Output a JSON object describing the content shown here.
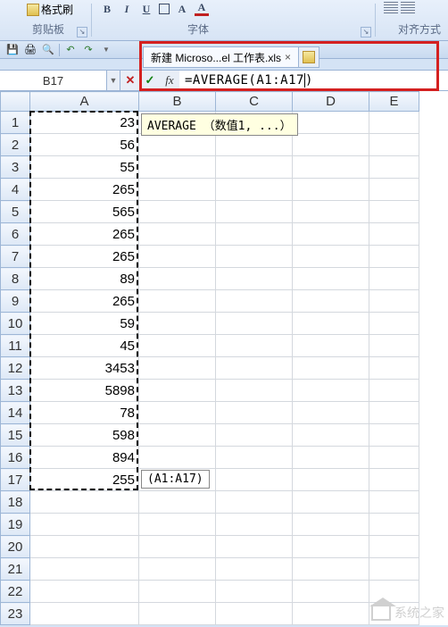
{
  "ribbon": {
    "format_painter": "格式刷",
    "group_clipboard": "剪贴板",
    "group_font": "字体",
    "group_align": "对齐方式"
  },
  "tab": {
    "title": "新建 Microso...el 工作表.xls"
  },
  "formula_bar": {
    "name_box": "B17",
    "formula": "=AVERAGE(A1:A17",
    "formula_tail": ")"
  },
  "tooltip_func": "AVERAGE （数值1, ...）",
  "tooltip_range": "(A1:A17)",
  "columns": [
    "A",
    "B",
    "C",
    "D",
    "E"
  ],
  "rows_count": 23,
  "cells": {
    "A1": "23",
    "A2": "56",
    "A3": "55",
    "A4": "265",
    "A5": "565",
    "A6": "265",
    "A7": "265",
    "A8": "89",
    "A9": "265",
    "A10": "59",
    "A11": "45",
    "A12": "3453",
    "A13": "5898",
    "A14": "78",
    "A15": "598",
    "A16": "894",
    "A17": "255"
  },
  "watermark": "系统之家"
}
